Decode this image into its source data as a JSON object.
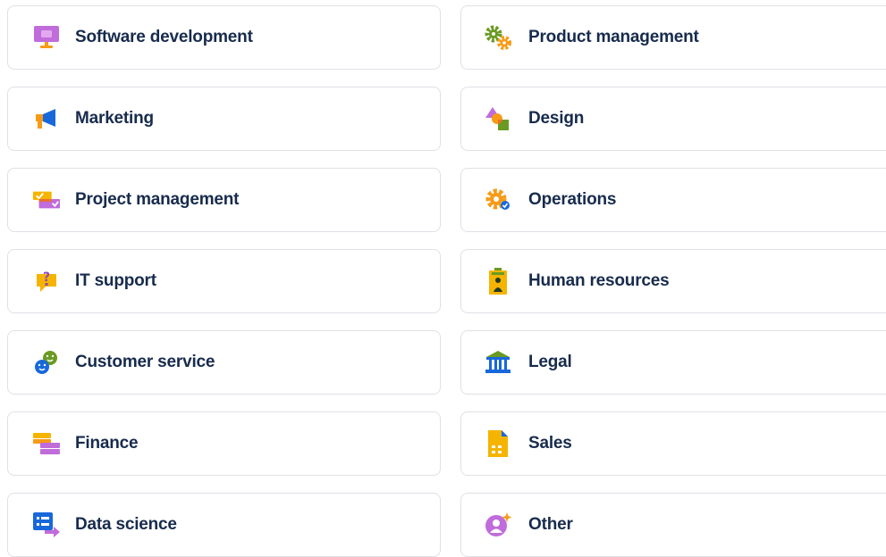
{
  "colors": {
    "card_border": "#dfe1e6",
    "text": "#172b4d",
    "purple": "#c06cdb",
    "orange": "#f79b17",
    "blue": "#1868db",
    "green": "#6a9a23",
    "yellow": "#f5b400"
  },
  "teams": {
    "left": [
      {
        "label": "Software development",
        "icon": "monitor-icon"
      },
      {
        "label": "Marketing",
        "icon": "megaphone-icon"
      },
      {
        "label": "Project management",
        "icon": "checklist-cards-icon"
      },
      {
        "label": "IT support",
        "icon": "question-bubble-icon"
      },
      {
        "label": "Customer service",
        "icon": "chat-faces-icon"
      },
      {
        "label": "Finance",
        "icon": "stacked-bills-icon"
      },
      {
        "label": "Data science",
        "icon": "data-list-icon"
      }
    ],
    "right": [
      {
        "label": "Product management",
        "icon": "gears-icon"
      },
      {
        "label": "Design",
        "icon": "shapes-icon"
      },
      {
        "label": "Operations",
        "icon": "gear-check-icon"
      },
      {
        "label": "Human resources",
        "icon": "id-badge-icon"
      },
      {
        "label": "Legal",
        "icon": "courthouse-icon"
      },
      {
        "label": "Sales",
        "icon": "document-icon"
      },
      {
        "label": "Other",
        "icon": "person-sparkle-icon"
      }
    ]
  }
}
